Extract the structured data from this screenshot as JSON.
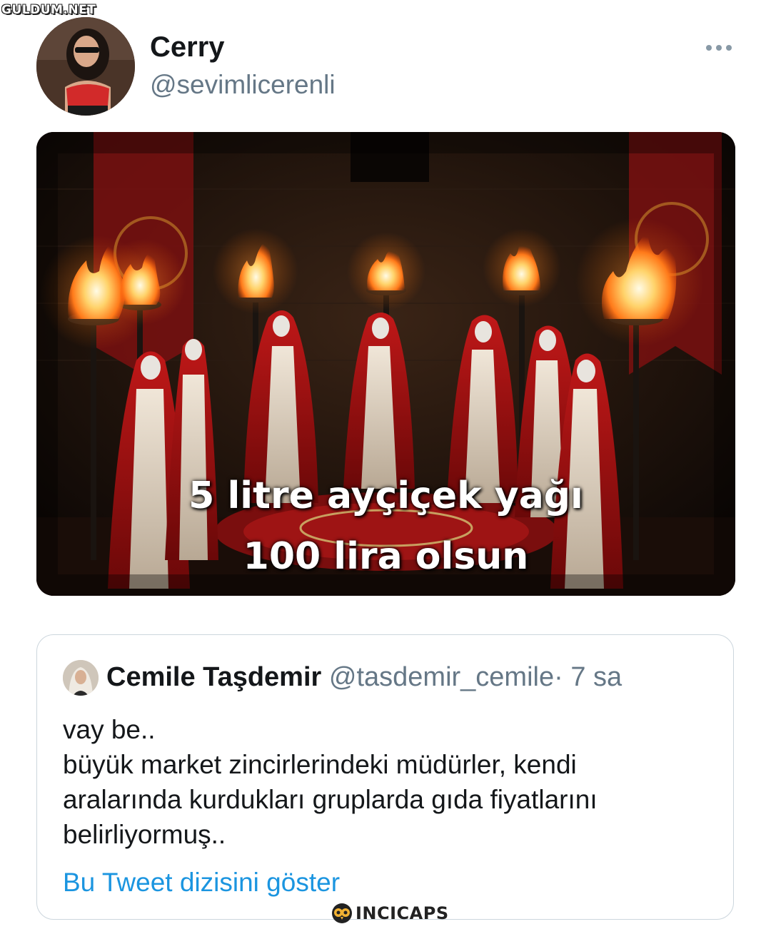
{
  "watermarks": {
    "top": "GULDUM.NET",
    "bottom": "INCICAPS"
  },
  "tweet": {
    "author_name": "Cerry",
    "author_handle": "@sevimlicerenli",
    "avatar_icon": "user-avatar-photo",
    "more_icon": "more-options-icon",
    "media": {
      "caption_line_1": "5 litre ayçiçek yağı",
      "caption_line_2": "100 lira olsun"
    }
  },
  "quoted_tweet": {
    "author_name": "Cemile Taşdemir",
    "author_handle": "@tasdemir_cemile",
    "separator": "·",
    "time": "7 sa",
    "body_lines": [
      "vay be..",
      "büyük market zincirlerindeki müdürler, kendi",
      "aralarında kurdukları gruplarda gıda fiyatlarını",
      "belirliyormuş.."
    ],
    "show_thread_label": "Bu Tweet dizisini göster"
  },
  "colors": {
    "text_primary": "#14171a",
    "text_secondary": "#657786",
    "link": "#1b95e0",
    "border": "#ccd6dd"
  }
}
